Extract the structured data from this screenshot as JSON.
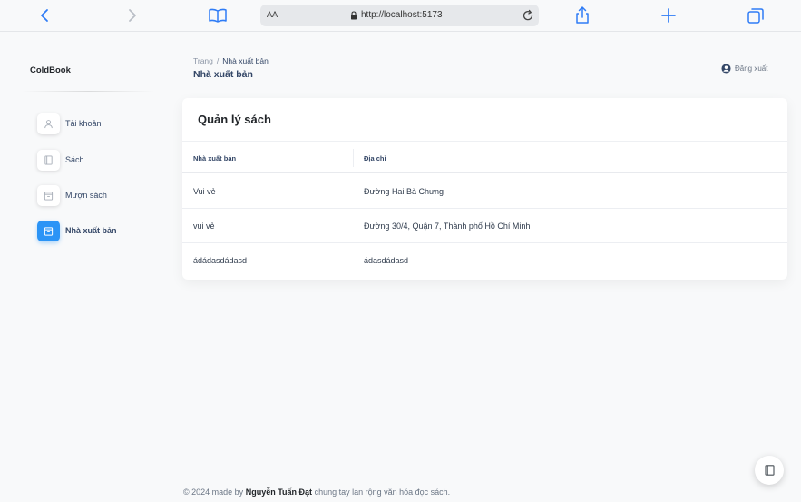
{
  "browser": {
    "text_size_label": "AA",
    "url": "http://localhost:5173",
    "accent_color": "#2f7cf6"
  },
  "sidebar": {
    "brand": "ColdBook",
    "items": [
      {
        "label": "Tài khoản",
        "icon": "user-icon",
        "active": false
      },
      {
        "label": "Sách",
        "icon": "book-icon",
        "active": false
      },
      {
        "label": "Mượn sách",
        "icon": "borrow-icon",
        "active": false
      },
      {
        "label": "Nhà xuất bản",
        "icon": "publisher-icon",
        "active": true
      }
    ],
    "active_color": "#2b94f6"
  },
  "header": {
    "breadcrumb_root": "Trang",
    "breadcrumb_separator": "/",
    "breadcrumb_current": "Nhà xuất bản",
    "title": "Nhà xuất bản",
    "logout_label": "Đăng xuất"
  },
  "card": {
    "title": "Quản lý sách",
    "columns": [
      "Nhà xuất bản",
      "Địa chỉ"
    ],
    "rows": [
      [
        "Vui vẻ",
        "Đường Hai Bà Chưng"
      ],
      [
        "vui vẻ",
        "Đường 30/4, Quận 7, Thành phố Hồ Chí Minh"
      ],
      [
        "ádádasdádasd",
        "ádasdádasd"
      ]
    ]
  },
  "footer": {
    "prefix": "© 2024 made by",
    "author": "Nguyễn Tuấn Đạt",
    "suffix": "chung tay lan rộng văn hóa đọc sách."
  }
}
